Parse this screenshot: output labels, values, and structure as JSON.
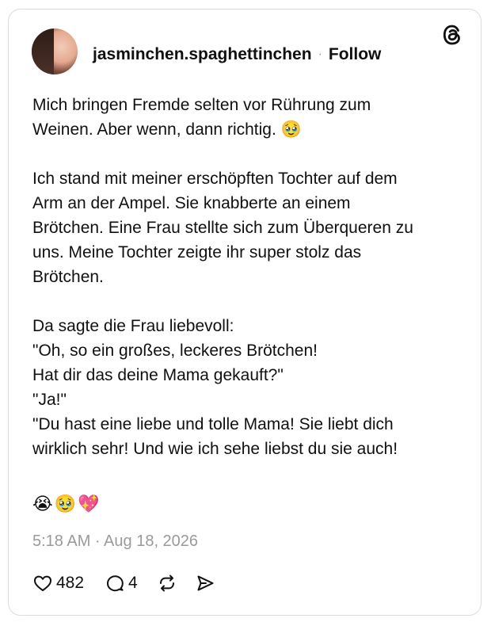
{
  "post": {
    "username": "jasminchen.spaghettinchen",
    "separator": "·",
    "follow_label": "Follow",
    "paragraphs": [
      [
        "Mich bringen Fremde selten vor Rührung zum",
        "Weinen. Aber wenn, dann richtig. 🥹"
      ],
      [
        "Ich stand mit meiner erschöpften Tochter auf dem",
        "Arm an der Ampel. Sie knabberte an einem",
        "Brötchen. Eine Frau stellte sich zum Überqueren zu",
        "uns. Meine Tochter zeigte ihr super stolz das",
        "Brötchen."
      ],
      [
        "Da sagte die Frau liebevoll:",
        "\"Oh, so ein großes, leckeres Brötchen!",
        "Hat dir das deine Mama gekauft?\"",
        "\"Ja!\"",
        "\"Du hast eine liebe und tolle Mama! Sie liebt dich",
        "wirklich sehr! Und wie ich sehe liebst du sie auch!"
      ]
    ],
    "emojis": [
      "😭",
      "🥹",
      "💖"
    ],
    "timestamp": "5:18 AM · Aug 18, 2026"
  },
  "actions": {
    "likes": "482",
    "replies": "4"
  },
  "icons": {
    "brand": "threads-logo-icon",
    "like": "heart-icon",
    "reply": "comment-icon",
    "repost": "repost-icon",
    "share": "send-icon"
  }
}
